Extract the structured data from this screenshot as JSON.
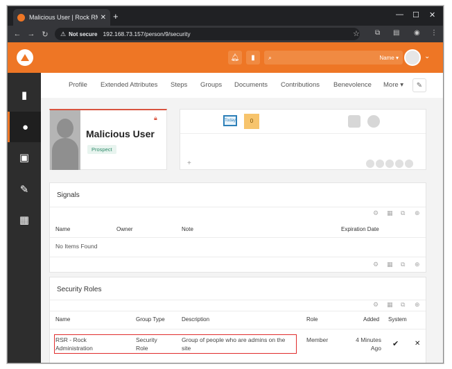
{
  "browser": {
    "tab_title": "Malicious User | Rock RMS",
    "url_warning": "Not secure",
    "url": "192.168.73.157/person/9/security"
  },
  "header": {
    "search_scope": "Name"
  },
  "person_tabs": [
    "Profile",
    "Extended Attributes",
    "Steps",
    "Groups",
    "Documents",
    "Contributions",
    "Benevolence",
    "More"
  ],
  "person": {
    "name": "Malicious User",
    "connection_status": "Prospect"
  },
  "badges": {
    "today_label": "Today",
    "count_label": "0"
  },
  "signals": {
    "title": "Signals",
    "columns": [
      "Name",
      "Owner",
      "Note",
      "Expiration Date"
    ],
    "empty_text": "No Items Found"
  },
  "security_roles": {
    "title": "Security Roles",
    "columns": [
      "Name",
      "Group Type",
      "Description",
      "Role",
      "Added",
      "System"
    ],
    "rows": [
      {
        "name": "RSR - Rock Administration",
        "group_type": "Security Role",
        "description": "Group of people who are admins on the site",
        "role": "Member",
        "added": "4 Minutes Ago",
        "system_icon": "check-icon",
        "delete_icon": "times-icon"
      }
    ]
  },
  "colors": {
    "brand": "#ee7625",
    "sidebar": "#2d2d2d",
    "highlight": "#e02b2b"
  }
}
